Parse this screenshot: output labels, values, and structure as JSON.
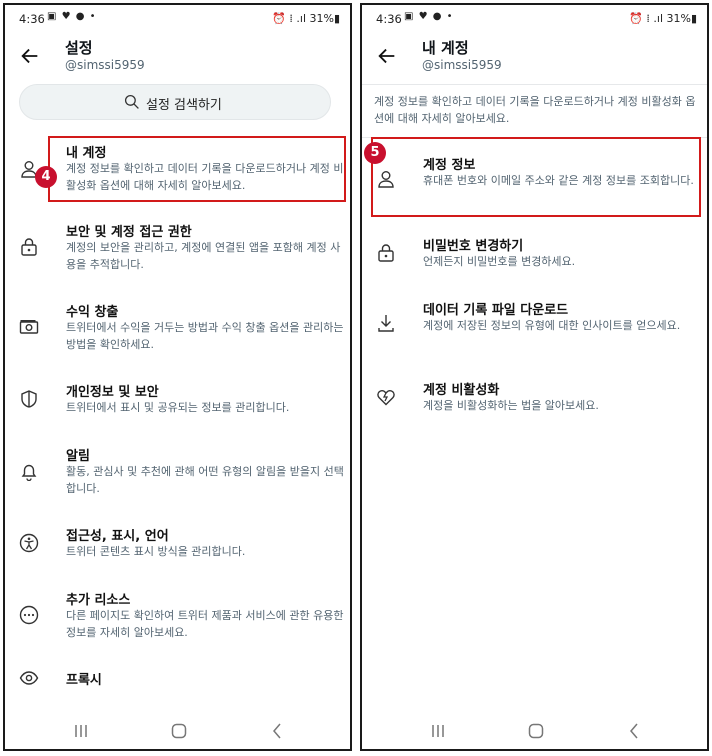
{
  "status_bar": {
    "time": "4:36",
    "left_icons": "▣ ♥ ● •",
    "right_icons": "⏰ ⁞ .ıl 31%▮"
  },
  "left_screen": {
    "title": "설정",
    "handle": "@simssi5959",
    "search_label": "설정 검색하기",
    "badge": "4",
    "items": [
      {
        "title": "내 계정",
        "desc": "계정 정보를 확인하고 데이터 기록을 다운로드하거나 계정 비활성화 옵션에 대해 자세히 알아보세요.",
        "icon": "person-icon"
      },
      {
        "title": "보안 및 계정 접근 권한",
        "desc": "계정의 보안을 관리하고, 계정에 연결된 앱을 포함해 계정 사용을 추적합니다.",
        "icon": "lock-icon"
      },
      {
        "title": "수익 창출",
        "desc": "트위터에서 수익을 거두는 방법과 수익 창출 옵션을 관리하는 방법을 확인하세요.",
        "icon": "money-icon"
      },
      {
        "title": "개인정보 및 보안",
        "desc": "트위터에서 표시 및 공유되는 정보를 관리합니다.",
        "icon": "shield-icon"
      },
      {
        "title": "알림",
        "desc": "활동, 관심사 및 추천에 관해 어떤 유형의 알림을 받을지 선택합니다.",
        "icon": "bell-icon"
      },
      {
        "title": "접근성, 표시, 언어",
        "desc": "트위터 콘텐츠 표시 방식을 관리합니다.",
        "icon": "accessibility-icon"
      },
      {
        "title": "추가 리소스",
        "desc": "다른 페이지도 확인하여 트위터 제품과 서비스에 관한 유용한 정보를 자세히 알아보세요.",
        "icon": "more-icon"
      },
      {
        "title": "프록시",
        "desc": "",
        "icon": "eye-icon"
      }
    ]
  },
  "right_screen": {
    "title": "내 계정",
    "handle": "@simssi5959",
    "intro": "계정 정보를 확인하고 데이터 기록을 다운로드하거나 계정 비활성화 옵션에 대해 자세히 알아보세요.",
    "badge": "5",
    "items": [
      {
        "title": "계정 정보",
        "desc": "휴대폰 번호와 이메일 주소와 같은 계정 정보를 조회합니다.",
        "icon": "person-icon"
      },
      {
        "title": "비밀번호 변경하기",
        "desc": "언제든지 비밀번호를 변경하세요.",
        "icon": "lock-icon"
      },
      {
        "title": "데이터 기록 파일 다운로드",
        "desc": "계정에 저장된 정보의 유형에 대한 인사이트를 얻으세요.",
        "icon": "download-icon"
      },
      {
        "title": "계정 비활성화",
        "desc": "계정을 비활성화하는 법을 알아보세요.",
        "icon": "broken-heart-icon"
      }
    ]
  },
  "colors": {
    "highlight": "#d21a1a",
    "badge": "#c8102e",
    "secondary_text": "#536471"
  }
}
